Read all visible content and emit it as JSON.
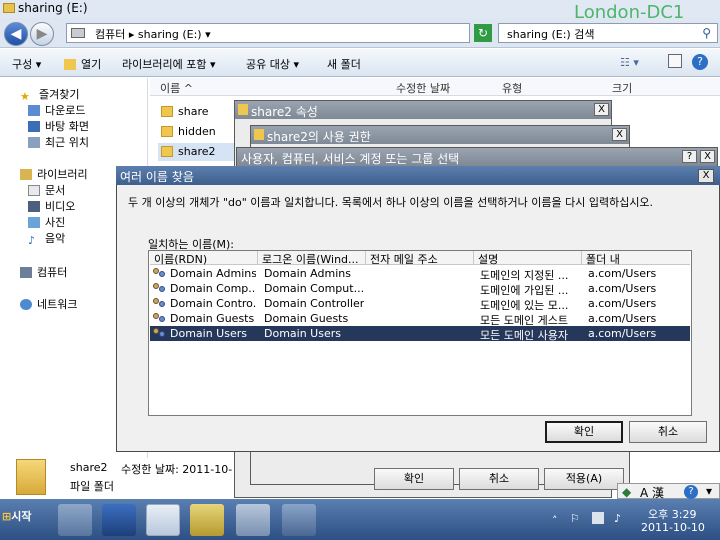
{
  "window": {
    "title": "sharing (E:)",
    "watermark": "London-DC1"
  },
  "address": {
    "path": "컴퓨터 ▸ sharing (E:) ▾",
    "search_placeholder": "sharing (E:) 검색"
  },
  "toolbar": {
    "organize": "구성 ▾",
    "open": "열기",
    "include_library": "라이브러리에 포함 ▾",
    "share_with": "공유 대상 ▾",
    "new_folder": "새 폴더"
  },
  "nav": {
    "favorites": "즐겨찾기",
    "downloads": "다운로드",
    "desktop": "바탕 화면",
    "recent": "최근 위치",
    "libraries": "라이브러리",
    "documents": "문서",
    "videos": "비디오",
    "pictures": "사진",
    "music": "음악",
    "computer": "컴퓨터",
    "network": "네트워크"
  },
  "columns": {
    "name": "이름",
    "modified": "수정한 날짜",
    "type": "유형",
    "size": "크기"
  },
  "files": [
    "share",
    "hidden",
    "share2"
  ],
  "details": {
    "name": "share2",
    "modified": "수정한 날짜: 2011-10-",
    "type": "파일 폴더"
  },
  "dialogs": {
    "properties": "share2 속성",
    "permissions": "share2의 사용 권한",
    "select": "사용자, 컴퓨터, 서비스 계정 또는 그룹 선택",
    "help": "?",
    "close": "X"
  },
  "multi": {
    "title": "여러 이름 찾음",
    "message": "두 개 이상의 개체가 \"do\" 이름과 일치합니다. 목록에서 하나 이상의 이름을 선택하거나 이름을 다시 입력하십시오.",
    "list_label": "일치하는 이름(M):",
    "headers": [
      "이름(RDN)",
      "로그온 이름(Wind...",
      "전자 메일 주소",
      "설명",
      "폴더 내"
    ],
    "rows": [
      [
        "Domain Admins",
        "Domain Admins",
        "",
        "도메인의 지정된 ...",
        "a.com/Users"
      ],
      [
        "Domain Comp...",
        "Domain Comput...",
        "",
        "도메인에 가입된 ...",
        "a.com/Users"
      ],
      [
        "Domain Contro...",
        "Domain Controllers",
        "",
        "도메인에 있는 모...",
        "a.com/Users"
      ],
      [
        "Domain Guests",
        "Domain Guests",
        "",
        "모든 도메인 게스트",
        "a.com/Users"
      ],
      [
        "Domain Users",
        "Domain Users",
        "",
        "모든 도메인 사용자",
        "a.com/Users"
      ]
    ],
    "selected_index": 4,
    "ok": "확인",
    "cancel": "취소"
  },
  "bottom": {
    "ok": "확인",
    "cancel": "취소",
    "apply": "적용(A)"
  },
  "ime": {
    "mode": "A 漢"
  },
  "taskbar": {
    "start": "시작",
    "time": "오후 3:29",
    "date": "2011-10-10"
  },
  "colors": {
    "selection": "#25375b",
    "title_active": "#4a6b9a",
    "folder": "#efc74f"
  }
}
